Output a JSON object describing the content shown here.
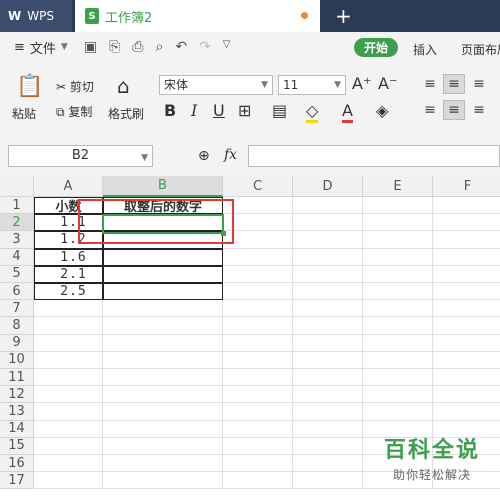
{
  "titlebar": {
    "app_tab": "WPS",
    "doc_tab": "工作簿2",
    "new_tab": "+"
  },
  "menubar": {
    "file": "文件",
    "start": "开始",
    "insert": "插入",
    "page_layout": "页面布局"
  },
  "ribbon": {
    "paste": "粘贴",
    "cut": "剪切",
    "copy": "复制",
    "format_painter": "格式刷",
    "font_name": "宋体",
    "font_size": "11",
    "bold": "B",
    "italic": "I",
    "underline": "U"
  },
  "formula": {
    "name_box": "B2",
    "fx": "fx",
    "value": ""
  },
  "sheet": {
    "columns": [
      "A",
      "B",
      "C",
      "D",
      "E",
      "F"
    ],
    "rows": [
      "1",
      "2",
      "3",
      "4",
      "5",
      "6",
      "7",
      "8",
      "9",
      "10",
      "11",
      "12",
      "13",
      "14",
      "15",
      "16",
      "17"
    ],
    "active_cell": "B2",
    "A": [
      "小数",
      "1.1",
      "1.2",
      "1.6",
      "2.1",
      "2.5"
    ],
    "B1": "取整后的数字"
  },
  "watermark": {
    "title": "百科全说",
    "subtitle": "助你轻松解决"
  },
  "colors": {
    "accent": "#3e9e4f",
    "titlebar": "#2c3b55",
    "highlight": "#e53935"
  }
}
